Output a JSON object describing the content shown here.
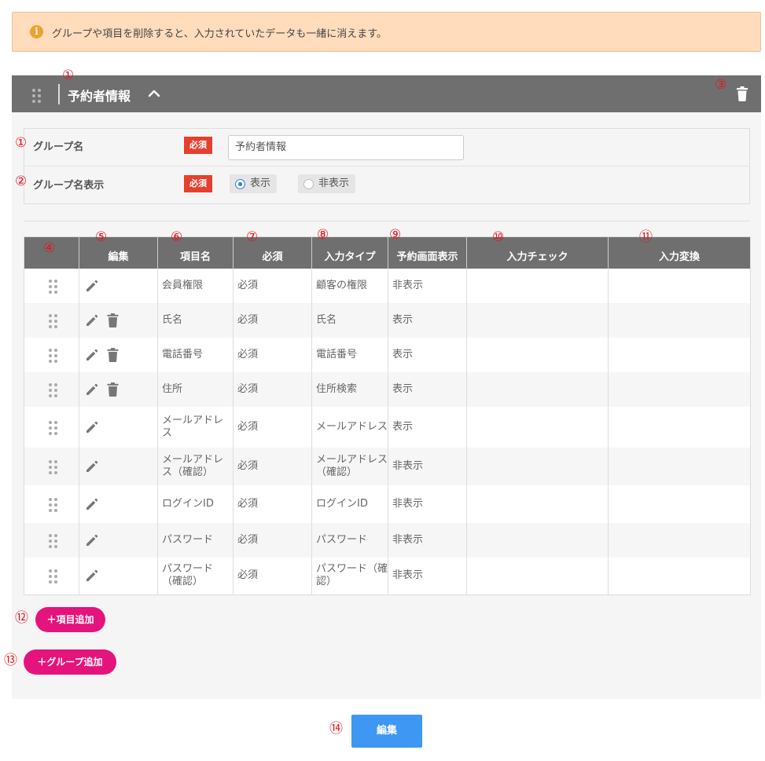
{
  "alert": {
    "icon": "info-icon",
    "text": "グループや項目を削除すると、入力されていたデータも一緒に消えます。"
  },
  "group": {
    "title": "予約者情報",
    "fields": [
      {
        "label": "グループ名",
        "required": "必須",
        "value": "予約者情報"
      },
      {
        "label": "グループ名表示",
        "required": "必須",
        "options": [
          "表示",
          "非表示"
        ],
        "selected": "表示"
      }
    ]
  },
  "table": {
    "headers": [
      "",
      "編集",
      "項目名",
      "必須",
      "入力タイプ",
      "予約画面表示",
      "入力チェック",
      "入力変換"
    ],
    "rows": [
      {
        "name": "会員権限",
        "required": "必須",
        "type": "顧客の権限",
        "display": "非表示",
        "check": "",
        "convert": "",
        "deletable": false
      },
      {
        "name": "氏名",
        "required": "必須",
        "type": "氏名",
        "display": "表示",
        "check": "",
        "convert": "",
        "deletable": true
      },
      {
        "name": "電話番号",
        "required": "必須",
        "type": "電話番号",
        "display": "表示",
        "check": "",
        "convert": "",
        "deletable": true
      },
      {
        "name": "住所",
        "required": "必須",
        "type": "住所検索",
        "display": "表示",
        "check": "",
        "convert": "",
        "deletable": true
      },
      {
        "name": "メールアドレス",
        "required": "必須",
        "type": "メールアドレス",
        "display": "表示",
        "check": "",
        "convert": "",
        "deletable": false
      },
      {
        "name": "メールアドレス（確認）",
        "required": "必須",
        "type": "メールアドレス（確認）",
        "display": "非表示",
        "check": "",
        "convert": "",
        "deletable": false
      },
      {
        "name": "ログインID",
        "required": "必須",
        "type": "ログインID",
        "display": "非表示",
        "check": "",
        "convert": "",
        "deletable": false
      },
      {
        "name": "パスワード",
        "required": "必須",
        "type": "パスワード",
        "display": "非表示",
        "check": "",
        "convert": "",
        "deletable": false
      },
      {
        "name": "パスワード（確認）",
        "required": "必須",
        "type": "パスワード（確認）",
        "display": "非表示",
        "check": "",
        "convert": "",
        "deletable": false
      }
    ]
  },
  "buttons": {
    "add_item": "＋項目追加",
    "add_group": "＋グループ追加",
    "edit": "編集"
  },
  "annotations": {
    "n1": "①",
    "n2": "②",
    "n3": "③",
    "n4": "④",
    "n5": "⑤",
    "n6": "⑥",
    "n7": "⑦",
    "n8": "⑧",
    "n9": "⑨",
    "n10": "⑩",
    "n11": "⑪",
    "n12": "⑫",
    "n13": "⑬",
    "n14": "⑭"
  },
  "colors": {
    "header_bg": "#6f6f6f",
    "required_badge": "#e53f2e",
    "pink_button": "#e5137c",
    "edit_button": "#3d97f3",
    "alert_bg": "#ffdcbc",
    "annotation": "#e8141c"
  }
}
